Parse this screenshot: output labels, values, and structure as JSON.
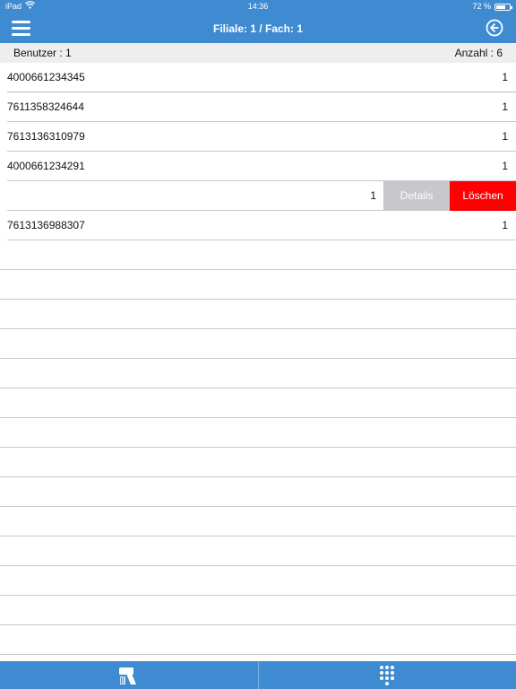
{
  "status_bar": {
    "device": "iPad",
    "time": "14:36",
    "battery": "72 %",
    "battery_level": 0.72
  },
  "nav": {
    "title": "Filiale: 1 / Fach: 1",
    "menu_icon": "hamburger-menu-icon",
    "back_icon": "back-arrow-circle-icon"
  },
  "summary": {
    "user_label": "Benutzer : 1",
    "count_label": "Anzahl : 6"
  },
  "items": [
    {
      "code": "4000661234345",
      "qty": "1"
    },
    {
      "code": "7611358324644",
      "qty": "1"
    },
    {
      "code": "7613136310979",
      "qty": "1"
    },
    {
      "code": "4000661234291",
      "qty": "1"
    },
    {
      "code": "",
      "qty": "1"
    },
    {
      "code": "7613136988307",
      "qty": "1"
    }
  ],
  "row_actions": {
    "details": "Details",
    "delete": "Löschen"
  },
  "tabbar": {
    "tabs": [
      {
        "icon": "barcode-scanner-icon"
      },
      {
        "icon": "keypad-icon"
      }
    ]
  },
  "colors": {
    "primary": "#3f8bd1",
    "delete": "#ff0000",
    "details": "#c7c7cc"
  }
}
